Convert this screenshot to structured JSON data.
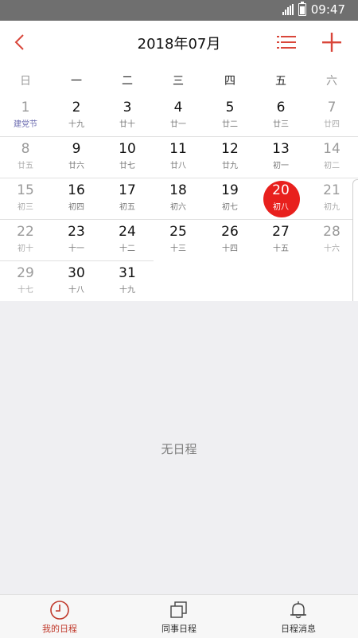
{
  "status_bar": {
    "time": "09:47"
  },
  "header": {
    "title": "2018年07月"
  },
  "weekdays": [
    "日",
    "一",
    "二",
    "三",
    "四",
    "五",
    "六"
  ],
  "calendar": {
    "today": "20",
    "weeks": [
      [
        {
          "day": "1",
          "lunar": "建党节"
        },
        {
          "day": "2",
          "lunar": "十九"
        },
        {
          "day": "3",
          "lunar": "廿十"
        },
        {
          "day": "4",
          "lunar": "廿一"
        },
        {
          "day": "5",
          "lunar": "廿二"
        },
        {
          "day": "6",
          "lunar": "廿三"
        },
        {
          "day": "7",
          "lunar": "廿四"
        }
      ],
      [
        {
          "day": "8",
          "lunar": "廿五"
        },
        {
          "day": "9",
          "lunar": "廿六"
        },
        {
          "day": "10",
          "lunar": "廿七"
        },
        {
          "day": "11",
          "lunar": "廿八"
        },
        {
          "day": "12",
          "lunar": "廿九"
        },
        {
          "day": "13",
          "lunar": "初一"
        },
        {
          "day": "14",
          "lunar": "初二"
        }
      ],
      [
        {
          "day": "15",
          "lunar": "初三"
        },
        {
          "day": "16",
          "lunar": "初四"
        },
        {
          "day": "17",
          "lunar": "初五"
        },
        {
          "day": "18",
          "lunar": "初六"
        },
        {
          "day": "19",
          "lunar": "初七"
        },
        {
          "day": "20",
          "lunar": "初八"
        },
        {
          "day": "21",
          "lunar": "初九"
        }
      ],
      [
        {
          "day": "22",
          "lunar": "初十"
        },
        {
          "day": "23",
          "lunar": "十一"
        },
        {
          "day": "24",
          "lunar": "十二"
        },
        {
          "day": "25",
          "lunar": "十三"
        },
        {
          "day": "26",
          "lunar": "十四"
        },
        {
          "day": "27",
          "lunar": "十五"
        },
        {
          "day": "28",
          "lunar": "十六"
        }
      ],
      [
        {
          "day": "29",
          "lunar": "十七"
        },
        {
          "day": "30",
          "lunar": "十八"
        },
        {
          "day": "31",
          "lunar": "十九"
        }
      ]
    ]
  },
  "empty_state": {
    "text": "无日程"
  },
  "tabbar": {
    "tabs": [
      {
        "label": "我的日程",
        "icon": "clock-icon",
        "active": true
      },
      {
        "label": "同事日程",
        "icon": "stacked-pages-icon",
        "active": false
      },
      {
        "label": "日程消息",
        "icon": "bell-icon",
        "active": false
      }
    ]
  },
  "colors": {
    "accent": "#e8201d",
    "header_icons": "#d9463a",
    "festival_text": "#6b6bb0"
  }
}
